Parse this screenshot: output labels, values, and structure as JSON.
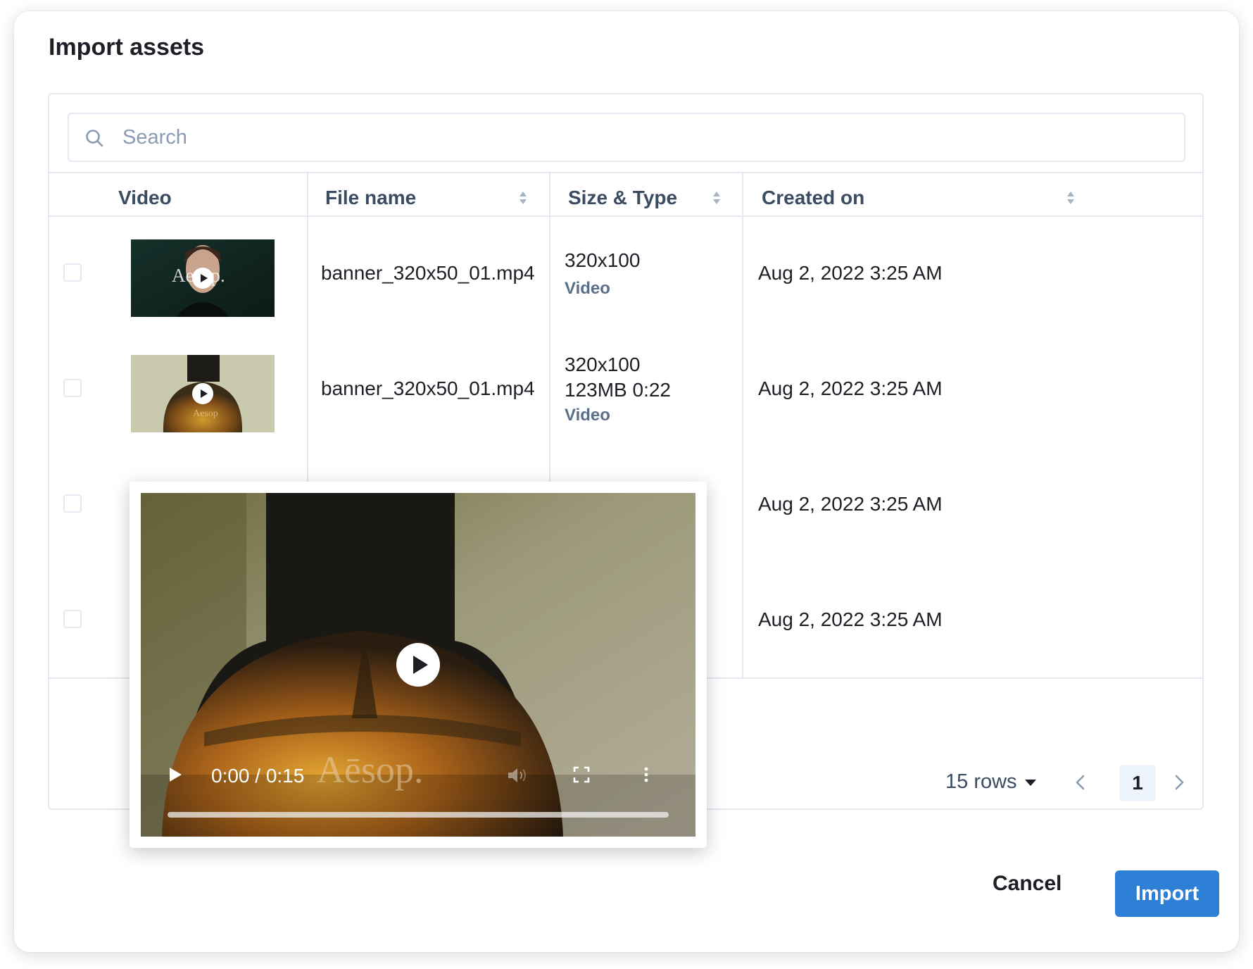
{
  "dialog": {
    "title": "Import assets"
  },
  "search": {
    "placeholder": "Search",
    "value": ""
  },
  "table": {
    "columns": [
      {
        "label": "Video",
        "sortable": false
      },
      {
        "label": "File name",
        "sortable": true
      },
      {
        "label": "Size & Type",
        "sortable": true
      },
      {
        "label": "Created on",
        "sortable": true
      }
    ],
    "rows": [
      {
        "file_name": "banner_320x50_01.mp4",
        "dimensions": "320x100",
        "meta": "",
        "type": "Video",
        "created_on": "Aug 2, 2022 3:25 AM",
        "thumb_text": "Aesop."
      },
      {
        "file_name": "banner_320x50_01.mp4",
        "dimensions": "320x100",
        "meta": "123MB 0:22",
        "type": "Video",
        "created_on": "Aug 2, 2022 3:25 AM",
        "thumb_text": "Aesop"
      },
      {
        "created_on": "Aug 2, 2022 3:25 AM"
      },
      {
        "created_on": "Aug 2, 2022 3:25 AM"
      }
    ]
  },
  "pagination": {
    "rows_label": "15 rows",
    "current_page": "1"
  },
  "video_preview": {
    "time": "0:00 / 0:15",
    "watermark": "Aēsop.",
    "progress": 0
  },
  "footer": {
    "cancel_label": "Cancel",
    "import_label": "Import"
  },
  "colors": {
    "primary": "#2e7fd6",
    "border": "#e3e8f1",
    "muted_text": "#5c6f88",
    "page_highlight": "#eef4fb"
  },
  "icons": {
    "search": "search-icon",
    "sort": "sort-icon",
    "play": "play-icon",
    "volume": "volume-icon",
    "fullscreen": "fullscreen-icon",
    "more": "more-vertical-icon",
    "prev": "chevron-left-icon",
    "next": "chevron-right-icon",
    "dropdown": "caret-down-icon"
  }
}
